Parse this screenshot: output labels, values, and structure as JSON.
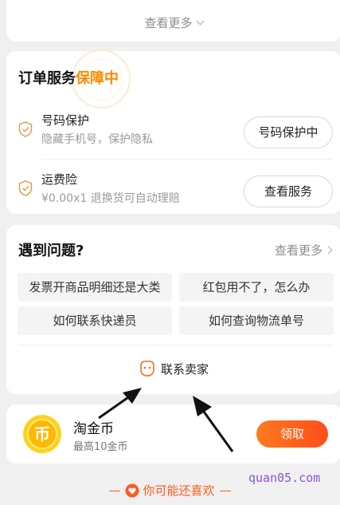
{
  "top_card": {
    "more_label": "查看更多"
  },
  "order_service": {
    "title_main": "订单服务",
    "title_highlight": "保障中",
    "items": [
      {
        "name": "号码保护",
        "desc": "隐藏手机号，保护隐私",
        "button": "号码保护中",
        "icon": "shield-check-icon"
      },
      {
        "name": "运费险",
        "desc": "¥0.00x1 退换货可自动理赔",
        "button": "查看服务",
        "icon": "shield-check-icon"
      }
    ]
  },
  "problems": {
    "title": "遇到问题?",
    "more_label": "查看更多",
    "chips": [
      "发票开商品明细还是大类",
      "红包用不了，怎么办",
      "如何联系快递员",
      "如何查询物流单号"
    ],
    "contact_label": "联系卖家"
  },
  "coin": {
    "name": "淘金币",
    "subtitle": "最高10金币",
    "button": "领取"
  },
  "footer": {
    "label": "你可能还喜欢"
  },
  "watermark_text": "quan05.com",
  "colors": {
    "accent": "#ff5a1f",
    "highlight": "#ff8a00",
    "coin": "#ffcc00"
  }
}
